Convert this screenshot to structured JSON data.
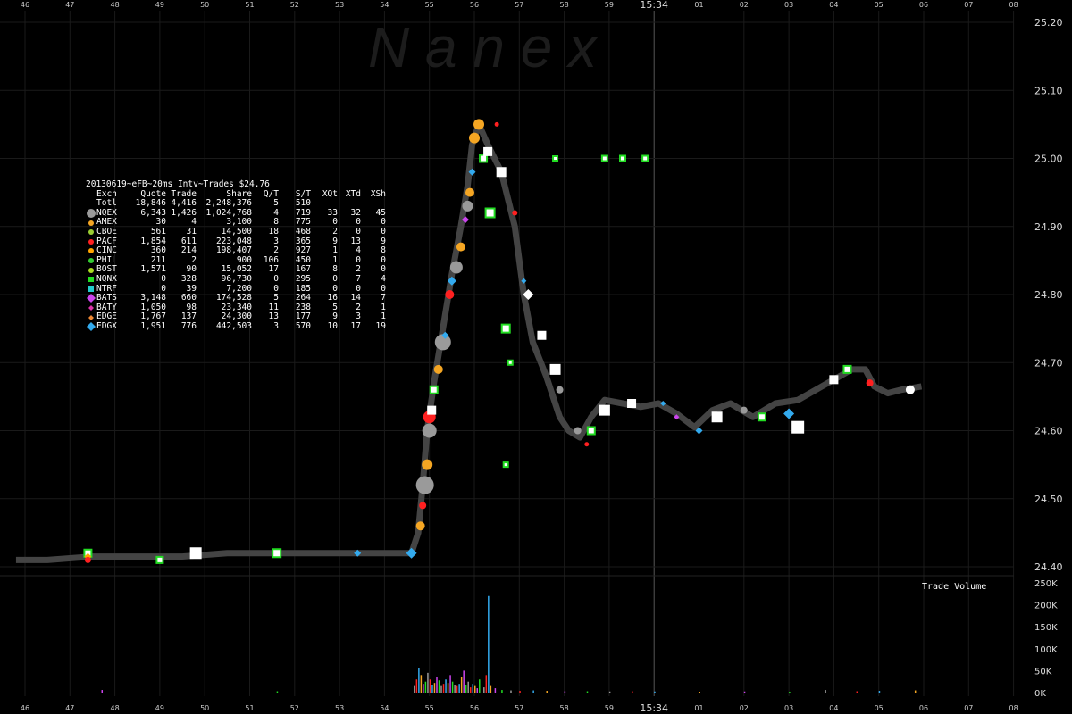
{
  "watermark": "N a n e x",
  "legend": {
    "title": "20130619~eFB~20ms Intv~Trades $24.76",
    "headers": [
      "Exch",
      "Quote",
      "Trade",
      "Share",
      "Q/T",
      "S/T",
      "XQt",
      "XTd",
      "XSh"
    ],
    "rows": [
      {
        "exch": "Totl",
        "quote": "18,846",
        "trade": "4,416",
        "share": "2,248,376",
        "qt": "5",
        "st": "510",
        "xqt": "",
        "xtd": "",
        "xsh": "",
        "color": "",
        "shape": "none"
      },
      {
        "exch": "NQEX",
        "quote": "6,343",
        "trade": "1,426",
        "share": "1,024,768",
        "qt": "4",
        "st": "719",
        "xqt": "33",
        "xtd": "32",
        "xsh": "45",
        "color": "#9a9a9a",
        "shape": "circle-lg"
      },
      {
        "exch": "AMEX",
        "quote": "30",
        "trade": "4",
        "share": "3,100",
        "qt": "8",
        "st": "775",
        "xqt": "0",
        "xtd": "0",
        "xsh": "0",
        "color": "#f5a623",
        "shape": "circle"
      },
      {
        "exch": "CBOE",
        "quote": "561",
        "trade": "31",
        "share": "14,500",
        "qt": "18",
        "st": "468",
        "xqt": "2",
        "xtd": "0",
        "xsh": "0",
        "color": "#9acd32",
        "shape": "circle"
      },
      {
        "exch": "PACF",
        "quote": "1,854",
        "trade": "611",
        "share": "223,048",
        "qt": "3",
        "st": "365",
        "xqt": "9",
        "xtd": "13",
        "xsh": "9",
        "color": "#ff2020",
        "shape": "circle"
      },
      {
        "exch": "CINC",
        "quote": "360",
        "trade": "214",
        "share": "198,407",
        "qt": "2",
        "st": "927",
        "xqt": "1",
        "xtd": "4",
        "xsh": "8",
        "color": "#ffa500",
        "shape": "circle"
      },
      {
        "exch": "PHIL",
        "quote": "211",
        "trade": "2",
        "share": "900",
        "qt": "106",
        "st": "450",
        "xqt": "1",
        "xtd": "0",
        "xsh": "0",
        "color": "#33cc33",
        "shape": "circle"
      },
      {
        "exch": "BOST",
        "quote": "1,571",
        "trade": "90",
        "share": "15,052",
        "qt": "17",
        "st": "167",
        "xqt": "8",
        "xtd": "2",
        "xsh": "0",
        "color": "#aadd22",
        "shape": "circle"
      },
      {
        "exch": "NQNX",
        "quote": "0",
        "trade": "328",
        "share": "96,730",
        "qt": "0",
        "st": "295",
        "xqt": "0",
        "xtd": "7",
        "xsh": "4",
        "color": "#22dd22",
        "shape": "square"
      },
      {
        "exch": "NTRF",
        "quote": "0",
        "trade": "39",
        "share": "7,200",
        "qt": "0",
        "st": "185",
        "xqt": "0",
        "xtd": "0",
        "xsh": "0",
        "color": "#22cccc",
        "shape": "square"
      },
      {
        "exch": "BATS",
        "quote": "3,148",
        "trade": "660",
        "share": "174,528",
        "qt": "5",
        "st": "264",
        "xqt": "16",
        "xtd": "14",
        "xsh": "7",
        "color": "#cc44ee",
        "shape": "diamond-lg"
      },
      {
        "exch": "BATY",
        "quote": "1,050",
        "trade": "98",
        "share": "23,340",
        "qt": "11",
        "st": "238",
        "xqt": "5",
        "xtd": "2",
        "xsh": "1",
        "color": "#dd33aa",
        "shape": "diamond"
      },
      {
        "exch": "EDGE",
        "quote": "1,767",
        "trade": "137",
        "share": "24,300",
        "qt": "13",
        "st": "177",
        "xqt": "9",
        "xtd": "3",
        "xsh": "1",
        "color": "#ee8833",
        "shape": "diamond"
      },
      {
        "exch": "EDGX",
        "quote": "1,951",
        "trade": "776",
        "share": "442,503",
        "qt": "3",
        "st": "570",
        "xqt": "10",
        "xtd": "17",
        "xsh": "19",
        "color": "#33aaee",
        "shape": "diamond-lg"
      }
    ]
  },
  "volume_label": "Trade Volume",
  "chart_data": {
    "type": "scatter",
    "x_tick_labels": [
      "46",
      "47",
      "48",
      "49",
      "50",
      "51",
      "52",
      "53",
      "54",
      "55",
      "56",
      "57",
      "58",
      "59",
      "15:34",
      "01",
      "02",
      "03",
      "04",
      "05",
      "06",
      "07",
      "08"
    ],
    "price_ticks": [
      "25.20",
      "25.10",
      "25.00",
      "24.90",
      "24.80",
      "24.70",
      "24.60",
      "24.50",
      "24.40"
    ],
    "price_ylim": [
      24.4,
      25.2
    ],
    "volume_ticks": [
      "250K",
      "200K",
      "150K",
      "100K",
      "50K",
      "0K"
    ],
    "volume_ylim": [
      0,
      250000
    ],
    "price_path": [
      [
        -0.2,
        24.41
      ],
      [
        0.5,
        24.41
      ],
      [
        1.5,
        24.415
      ],
      [
        2.5,
        24.415
      ],
      [
        3.5,
        24.415
      ],
      [
        4.5,
        24.42
      ],
      [
        5.5,
        24.42
      ],
      [
        6.5,
        24.42
      ],
      [
        7.5,
        24.42
      ],
      [
        8.6,
        24.42
      ],
      [
        8.75,
        24.45
      ],
      [
        8.85,
        24.52
      ],
      [
        8.95,
        24.6
      ],
      [
        9.1,
        24.67
      ],
      [
        9.3,
        24.75
      ],
      [
        9.5,
        24.83
      ],
      [
        9.7,
        24.9
      ],
      [
        9.85,
        24.96
      ],
      [
        9.95,
        25.02
      ],
      [
        10.1,
        25.05
      ],
      [
        10.3,
        25.02
      ],
      [
        10.6,
        24.98
      ],
      [
        10.9,
        24.9
      ],
      [
        11.1,
        24.8
      ],
      [
        11.3,
        24.73
      ],
      [
        11.6,
        24.68
      ],
      [
        11.9,
        24.62
      ],
      [
        12.1,
        24.6
      ],
      [
        12.35,
        24.59
      ],
      [
        12.6,
        24.62
      ],
      [
        12.9,
        24.645
      ],
      [
        13.3,
        24.64
      ],
      [
        13.7,
        24.635
      ],
      [
        14.1,
        24.64
      ],
      [
        14.5,
        24.625
      ],
      [
        14.9,
        24.605
      ],
      [
        15.3,
        24.63
      ],
      [
        15.7,
        24.64
      ],
      [
        16.2,
        24.62
      ],
      [
        16.7,
        24.64
      ],
      [
        17.2,
        24.645
      ],
      [
        17.6,
        24.66
      ],
      [
        18.0,
        24.675
      ],
      [
        18.4,
        24.69
      ],
      [
        18.7,
        24.69
      ],
      [
        18.9,
        24.665
      ],
      [
        19.2,
        24.655
      ],
      [
        19.5,
        24.66
      ],
      [
        19.95,
        24.665
      ]
    ],
    "volume_bars": [
      [
        8.65,
        15000
      ],
      [
        8.7,
        30000
      ],
      [
        8.75,
        55000
      ],
      [
        8.8,
        40000
      ],
      [
        8.85,
        20000
      ],
      [
        8.9,
        25000
      ],
      [
        8.95,
        45000
      ],
      [
        9.0,
        30000
      ],
      [
        9.05,
        18000
      ],
      [
        9.1,
        22000
      ],
      [
        9.15,
        35000
      ],
      [
        9.2,
        28000
      ],
      [
        9.25,
        15000
      ],
      [
        9.3,
        20000
      ],
      [
        9.35,
        30000
      ],
      [
        9.4,
        22000
      ],
      [
        9.45,
        40000
      ],
      [
        9.5,
        25000
      ],
      [
        9.55,
        18000
      ],
      [
        9.6,
        15000
      ],
      [
        9.65,
        20000
      ],
      [
        9.7,
        35000
      ],
      [
        9.75,
        50000
      ],
      [
        9.8,
        18000
      ],
      [
        9.85,
        25000
      ],
      [
        9.9,
        12000
      ],
      [
        9.95,
        20000
      ],
      [
        10.0,
        15000
      ],
      [
        10.05,
        10000
      ],
      [
        10.1,
        30000
      ],
      [
        10.2,
        12000
      ],
      [
        10.25,
        40000
      ],
      [
        10.3,
        220000
      ],
      [
        10.35,
        15000
      ],
      [
        10.45,
        10000
      ],
      [
        10.6,
        6000
      ],
      [
        10.8,
        5000
      ],
      [
        11.0,
        4000
      ],
      [
        11.3,
        5000
      ],
      [
        11.6,
        4000
      ],
      [
        12.0,
        3000
      ],
      [
        12.5,
        3000
      ],
      [
        13.0,
        2500
      ],
      [
        13.5,
        3000
      ],
      [
        14.0,
        2500
      ],
      [
        15.0,
        2000
      ],
      [
        16.0,
        2500
      ],
      [
        17.0,
        2000
      ],
      [
        17.8,
        6000
      ],
      [
        18.5,
        3000
      ],
      [
        19.0,
        4000
      ],
      [
        19.8,
        5000
      ],
      [
        1.7,
        6000
      ],
      [
        5.6,
        3000
      ]
    ],
    "markers": [
      [
        1.4,
        24.42,
        "#22dd22",
        "square",
        8
      ],
      [
        1.4,
        24.415,
        "#ffa500",
        "diamond",
        8
      ],
      [
        1.4,
        24.41,
        "#ff2020",
        "circle",
        7
      ],
      [
        3.0,
        24.41,
        "#22dd22",
        "square",
        7
      ],
      [
        3.8,
        24.42,
        "#ffffff",
        "square",
        11
      ],
      [
        5.6,
        24.42,
        "#22dd22",
        "square",
        9
      ],
      [
        7.4,
        24.42,
        "#33aaee",
        "diamond",
        8
      ],
      [
        8.6,
        24.42,
        "#33aaee",
        "diamond",
        12
      ],
      [
        8.8,
        24.46,
        "#f5a623",
        "circle",
        10
      ],
      [
        8.85,
        24.49,
        "#ff2020",
        "circle",
        8
      ],
      [
        8.9,
        24.52,
        "#9a9a9a",
        "circle",
        20
      ],
      [
        8.95,
        24.55,
        "#f5a623",
        "circle",
        12
      ],
      [
        9.0,
        24.6,
        "#9a9a9a",
        "circle",
        16
      ],
      [
        9.0,
        24.62,
        "#ff2020",
        "circle",
        14
      ],
      [
        9.05,
        24.63,
        "#ffffff",
        "square",
        8
      ],
      [
        9.1,
        24.66,
        "#22dd22",
        "square",
        8
      ],
      [
        9.2,
        24.69,
        "#f5a623",
        "circle",
        10
      ],
      [
        9.3,
        24.73,
        "#9a9a9a",
        "circle",
        18
      ],
      [
        9.35,
        24.74,
        "#33aaee",
        "diamond",
        8
      ],
      [
        9.45,
        24.8,
        "#ff2020",
        "circle",
        10
      ],
      [
        9.5,
        24.82,
        "#33aaee",
        "diamond",
        10
      ],
      [
        9.6,
        24.84,
        "#9a9a9a",
        "circle",
        14
      ],
      [
        9.7,
        24.87,
        "#f5a623",
        "circle",
        10
      ],
      [
        9.8,
        24.91,
        "#cc44ee",
        "diamond",
        8
      ],
      [
        9.85,
        24.93,
        "#9a9a9a",
        "circle",
        12
      ],
      [
        9.9,
        24.95,
        "#f5a623",
        "circle",
        10
      ],
      [
        9.95,
        24.98,
        "#33aaee",
        "diamond",
        8
      ],
      [
        10.0,
        25.03,
        "#f5a623",
        "circle",
        12
      ],
      [
        10.1,
        25.05,
        "#f5a623",
        "circle",
        12
      ],
      [
        10.2,
        25.0,
        "#22dd22",
        "square",
        8
      ],
      [
        10.3,
        25.01,
        "#ffffff",
        "square",
        8
      ],
      [
        10.35,
        24.92,
        "#22dd22",
        "square",
        10
      ],
      [
        10.6,
        24.98,
        "#ffffff",
        "square",
        9
      ],
      [
        10.9,
        24.92,
        "#ff2020",
        "circle",
        6
      ],
      [
        11.1,
        24.82,
        "#33aaee",
        "diamond",
        6
      ],
      [
        11.2,
        24.8,
        "#ffffff",
        "diamond",
        12
      ],
      [
        11.5,
        24.74,
        "#ffffff",
        "square",
        8
      ],
      [
        11.8,
        24.69,
        "#ffffff",
        "square",
        10
      ],
      [
        11.9,
        24.66,
        "#9a9a9a",
        "circle",
        8
      ],
      [
        12.3,
        24.6,
        "#9a9a9a",
        "circle",
        8
      ],
      [
        12.5,
        24.58,
        "#ff2020",
        "circle",
        5
      ],
      [
        12.6,
        24.6,
        "#22dd22",
        "square",
        8
      ],
      [
        12.9,
        24.63,
        "#ffffff",
        "square",
        10
      ],
      [
        13.5,
        24.64,
        "#ffffff",
        "square",
        8
      ],
      [
        14.2,
        24.64,
        "#33aaee",
        "diamond",
        6
      ],
      [
        14.5,
        24.62,
        "#cc44ee",
        "diamond",
        6
      ],
      [
        15.0,
        24.6,
        "#33aaee",
        "diamond",
        8
      ],
      [
        15.4,
        24.62,
        "#ffffff",
        "square",
        10
      ],
      [
        16.0,
        24.63,
        "#9a9a9a",
        "circle",
        8
      ],
      [
        16.4,
        24.62,
        "#22dd22",
        "square",
        8
      ],
      [
        17.0,
        24.625,
        "#33aaee",
        "diamond",
        12
      ],
      [
        17.2,
        24.605,
        "#ffffff",
        "square",
        12
      ],
      [
        18.0,
        24.675,
        "#ffffff",
        "square",
        8
      ],
      [
        18.3,
        24.69,
        "#22dd22",
        "square",
        8
      ],
      [
        18.8,
        24.67,
        "#ff2020",
        "circle",
        8
      ],
      [
        19.7,
        24.66,
        "#ffffff",
        "circle",
        10
      ],
      [
        12.9,
        25.0,
        "#22dd22",
        "square",
        6
      ],
      [
        13.3,
        25.0,
        "#22dd22",
        "square",
        6
      ],
      [
        13.8,
        25.0,
        "#22dd22",
        "square",
        6
      ],
      [
        11.8,
        25.0,
        "#22dd22",
        "square",
        5
      ],
      [
        10.7,
        24.75,
        "#22dd22",
        "square",
        9
      ],
      [
        10.7,
        24.55,
        "#22dd22",
        "square",
        5
      ],
      [
        10.8,
        24.7,
        "#22dd22",
        "square",
        5
      ],
      [
        10.5,
        25.05,
        "#ff2020",
        "circle",
        5
      ]
    ]
  }
}
